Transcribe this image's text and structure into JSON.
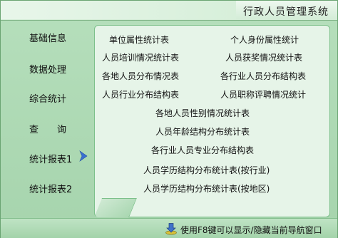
{
  "window": {
    "title": "行政人员管理系统"
  },
  "sidebar": {
    "items": [
      {
        "label": "基础信息"
      },
      {
        "label": "数据处理"
      },
      {
        "label": "综合统计"
      },
      {
        "label": "查　　询"
      },
      {
        "label": "统计报表1",
        "active": true
      },
      {
        "label": "统计报表2"
      }
    ],
    "active_indicator_icon": "chevron-right-icon"
  },
  "reports": {
    "items": [
      {
        "label": "单位属性统计表"
      },
      {
        "label": "个人身份属性统计"
      },
      {
        "label": "人员培训情况统计表"
      },
      {
        "label": "人员获奖情况统计表"
      },
      {
        "label": "各地人员分布情况表"
      },
      {
        "label": "各行业人员分布结构表"
      },
      {
        "label": "人员行业分布结构表"
      },
      {
        "label": "人员职称评聘情况统计"
      },
      {
        "label": "各地人员性别情况统计表"
      },
      {
        "label": "人员年龄结构分布统计表"
      },
      {
        "label": "各行业人员专业分布结构表"
      },
      {
        "label": "人员学历结构分布统计表(按行业)"
      },
      {
        "label": "人员学历结构分布统计表(按地区)"
      }
    ]
  },
  "statusbar": {
    "icon": "download-arrow-icon",
    "hint": "使用F8键可以显示/隐藏当前导航窗口"
  },
  "colors": {
    "background": "#a6d4ad",
    "panel": "#e6f4e8",
    "panel_border": "#7cc08a",
    "arrow": "#3a6fd0"
  }
}
